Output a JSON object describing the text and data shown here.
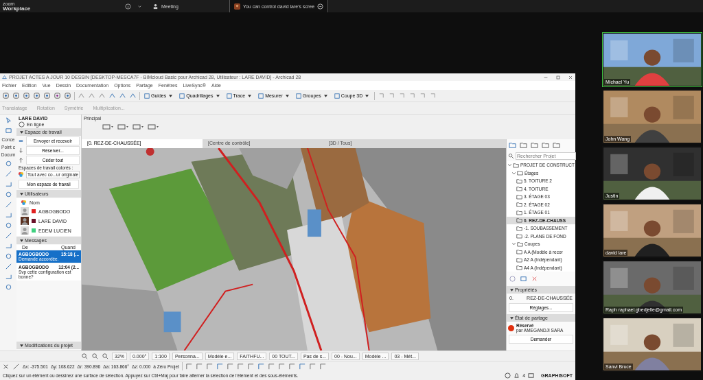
{
  "zoom_bar": {
    "logo_small": "zoom",
    "logo": "Workplace",
    "tabs": [
      {
        "label": "Meeting",
        "selected": false
      },
      {
        "label": "You can control david lare's scree",
        "selected": true
      }
    ]
  },
  "app": {
    "title": "PROJET ACTES A JOUR 10 DESSIN [DESKTOP-MESCA7F - BIMcloud Basic pour Archicad 28, Utilisateur : LARE DAVID] - Archicad 28",
    "menu": [
      "Fichier",
      "Edition",
      "Vue",
      "Dessin",
      "Documentation",
      "Options",
      "Partage",
      "Fenêtres",
      "LiveSync®",
      "Aide"
    ],
    "toolbar_labels": [
      "Guides",
      "Quadrillages",
      "Trace",
      "Mesurer",
      "Groupes",
      "Coupe 3D"
    ],
    "edit_tools": [
      "Translatage",
      "Rotation",
      "Symétrie",
      "Multiplication..."
    ],
    "info_box_label": "Principal",
    "toolbox_labels": [
      "Conce",
      "Point c",
      "Docum"
    ],
    "view_tabs": [
      {
        "label": "[0. REZ-DE-CHAUSSÉE]",
        "selected": true
      },
      {
        "label": "[Centre de contrôle]",
        "selected": false
      },
      {
        "label": "[3D / Tous]",
        "selected": false
      }
    ]
  },
  "teamwork": {
    "user": "LARE DAVID",
    "status": "En ligne",
    "workspace_header": "Espace de travail",
    "send": "Envoyer et recevoir",
    "reserve": "Réserver...",
    "release": "Céder tout",
    "colored_label": "Espaces de travail colorés :",
    "colored_value": "Tout avec co...ur originale",
    "my_workspace": "Mon espace de travail",
    "users_header": "Utilisateurs",
    "users_column": "Nom",
    "users": [
      {
        "name": "AGBOGBODO",
        "color": "#e02020"
      },
      {
        "name": "LARE DAVID",
        "color": "#6a1028"
      },
      {
        "name": "EDEM LUCIEN",
        "color": "#40d080"
      }
    ],
    "messages_header": "Messages",
    "message_columns": [
      "De",
      "Quand"
    ],
    "messages": [
      {
        "from": "AGBOGBODO",
        "time": "15:18 (...",
        "text": "Demande accordée.",
        "selected": true
      },
      {
        "from": "AGBOGBODO",
        "time": "12:04 (2...",
        "text": "Svp cette configuration est bonne?",
        "selected": false
      }
    ],
    "changes_header": "Modifications du projet"
  },
  "navigator": {
    "search_placeholder": "Rechercher Projet",
    "tree": [
      {
        "label": "PROJET DE CONSTRUCT",
        "expanded": true,
        "selected": false,
        "children": [
          {
            "label": "Étages",
            "expanded": true,
            "selected": false,
            "children": [
              {
                "label": "5. TOITURE 2",
                "selected": false
              },
              {
                "label": "4. TOITURE",
                "selected": false
              },
              {
                "label": "3. ÉTAGE 03",
                "selected": false
              },
              {
                "label": "2. ÉTAGE 02",
                "selected": false
              },
              {
                "label": "1. ÉTAGE 01",
                "selected": false
              },
              {
                "label": "0. REZ-DE-CHAUSS",
                "selected": true
              },
              {
                "label": "-1. SOUBASSEMENT",
                "selected": false
              },
              {
                "label": "-2. PLANS DE FOND",
                "selected": false
              }
            ]
          },
          {
            "label": "Coupes",
            "expanded": true,
            "selected": false,
            "children": [
              {
                "label": "A A (Modèle à recor",
                "selected": false
              },
              {
                "label": "A2 A (Indépendant)",
                "selected": false
              },
              {
                "label": "A4 A (Indépendant)",
                "selected": false
              }
            ]
          }
        ]
      }
    ],
    "properties": {
      "header": "Propriétés",
      "id": "0.",
      "name": "REZ-DE-CHAUSSÉE",
      "button": "Réglages..."
    },
    "sharing": {
      "header": "État de partage",
      "status": "Réservé",
      "by": "par AMEGANDJI SARA",
      "button": "Demander",
      "color": "#e03010"
    }
  },
  "bottom": {
    "fields": [
      "32%",
      "0.000°",
      "1:100",
      "Personna...",
      "Modèle e...",
      "FAITHFU...",
      "00 TOUT...",
      "Pas de s...",
      "00 - Nou...",
      "Modèle ...",
      "03 - Mét..."
    ],
    "coords": [
      "Δx: -375.501",
      "Δy: 108.622",
      "Δr: 390.896",
      "Δa: 163.866°",
      "Δz: 0.000",
      "à Zéro Projet"
    ]
  },
  "status": {
    "text": "Cliquez sur un élément ou dessinez une surface de sélection. Appuyez sur Ctrl+Maj pour faire alterner la sélection de l'élément et des sous-éléments.",
    "notifications": "4",
    "brand": "GRAPHISOFT"
  },
  "participants": [
    {
      "name": "Michael Yu",
      "highlighted": true
    },
    {
      "name": "John Wang",
      "highlighted": false
    },
    {
      "name": "Justin",
      "highlighted": false
    },
    {
      "name": "david lare",
      "highlighted": false
    },
    {
      "name": "Raph raphael.gbedjelle@gmail.com",
      "highlighted": false
    },
    {
      "name": "Sanvi Bruce",
      "highlighted": false
    }
  ]
}
